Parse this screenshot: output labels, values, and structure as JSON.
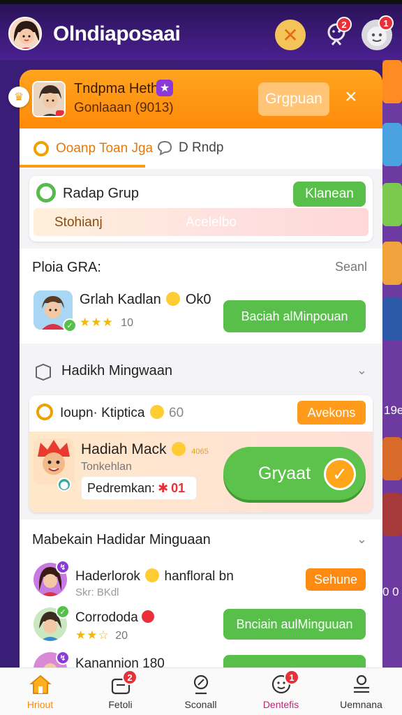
{
  "app": {
    "title": "Olndiaposaai"
  },
  "header_badges": {
    "alert": "2",
    "chat": "1"
  },
  "modal": {
    "name": "Tndpma Heth",
    "subtitle": "Gonlaaan (9013)",
    "group_button": "Grgpuan",
    "close": "×"
  },
  "tabs": [
    {
      "label": "Ooanp Toan Jga"
    },
    {
      "label": "D Rndp"
    }
  ],
  "group": {
    "label": "Radap Grup",
    "button": "Klanean",
    "search_label": "Stohianj",
    "search_hint": "Acelelbo"
  },
  "section_a": {
    "title": "Ploia GRA:",
    "right": "Seanl",
    "item": {
      "name": "Grlah Kadlan",
      "suffix": "Ok0",
      "stars": "★★★",
      "meta": "10",
      "button": "Baciah alMinpouan"
    }
  },
  "section_b": {
    "title": "Hadikh Mingwaan",
    "head": {
      "name": "Ioupn· Ktiptica",
      "suffix": "60",
      "button": "Avekons"
    },
    "reward": {
      "title": "Hadiah Mack",
      "tag": "4065",
      "sub": "Tonkehlan",
      "remind": "Pedremkan:",
      "remind_num": "01",
      "claim": "Gryaat"
    }
  },
  "section_c": {
    "title": "Mabekain Hadidar Minguaan",
    "items": [
      {
        "name": "Haderlorok",
        "name2": "hanfloral bn",
        "meta": "Skr: BKdl",
        "button": "Sehune",
        "badge_color": "#8a3ad6"
      },
      {
        "name": "Corrododa",
        "name2": "",
        "meta": "20",
        "stars": "★★☆",
        "button": "Bnciain aulMinguuan",
        "badge_color": "#58c04a"
      },
      {
        "name": "Kanannion 180",
        "name2": "",
        "meta": "",
        "button": "",
        "badge_color": "#8a3ad6"
      }
    ]
  },
  "side_text": {
    "a": "19e",
    "b": "0 0"
  },
  "bottom_nav": [
    {
      "label": "Hriout",
      "badge": "",
      "color": "#ff8a00"
    },
    {
      "label": "Fetoli",
      "badge": "2",
      "color": "#333"
    },
    {
      "label": "Sconall",
      "badge": "",
      "color": "#333"
    },
    {
      "label": "Dentefis",
      "badge": "1",
      "color": "#c0237a"
    },
    {
      "label": "Uemnana",
      "badge": "",
      "color": "#333"
    }
  ],
  "colors": {
    "accent": "#ff9a14",
    "green": "#58c04a",
    "purple": "#4a2090"
  },
  "icons": [
    "close-icon",
    "alert-person-icon",
    "chat-face-icon",
    "home-icon",
    "bag-icon",
    "search-person-icon",
    "smile-icon",
    "menu-user-icon"
  ]
}
